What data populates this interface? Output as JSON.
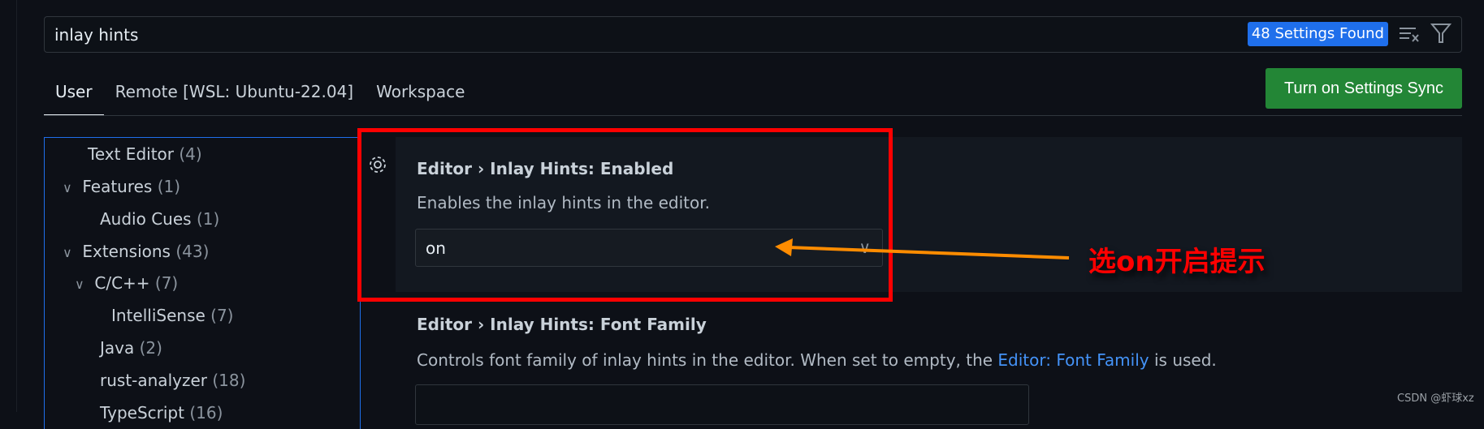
{
  "search": {
    "value": "inlay hints",
    "results_badge": "48 Settings Found"
  },
  "tabs": [
    {
      "label": "User"
    },
    {
      "label": "Remote [WSL: Ubuntu-22.04]"
    },
    {
      "label": "Workspace"
    }
  ],
  "sync_button": "Turn on Settings Sync",
  "tree": [
    {
      "label": "Text Editor",
      "count": "(4)"
    },
    {
      "label": "Features",
      "count": "(1)"
    },
    {
      "label": "Audio Cues",
      "count": "(1)"
    },
    {
      "label": "Extensions",
      "count": "(43)"
    },
    {
      "label": "C/C++",
      "count": "(7)"
    },
    {
      "label": "IntelliSense",
      "count": "(7)"
    },
    {
      "label": "Java",
      "count": "(2)"
    },
    {
      "label": "rust-analyzer",
      "count": "(18)"
    },
    {
      "label": "TypeScript",
      "count": "(16)"
    }
  ],
  "settings": [
    {
      "title": "Editor › Inlay Hints: Enabled",
      "description": "Enables the inlay hints in the editor.",
      "value": "on"
    },
    {
      "title": "Editor › Inlay Hints: Font Family",
      "description_before": "Controls font family of inlay hints in the editor. When set to empty, the ",
      "description_link": "Editor: Font Family",
      "description_after": " is used.",
      "value": ""
    }
  ],
  "annotation": "选on开启提示",
  "watermark": "CSDN @虾球xz",
  "colors": {
    "accent": "#1f6feb",
    "sync": "#238636",
    "annotation": "#ff0000",
    "arrow": "#ff8c00"
  }
}
